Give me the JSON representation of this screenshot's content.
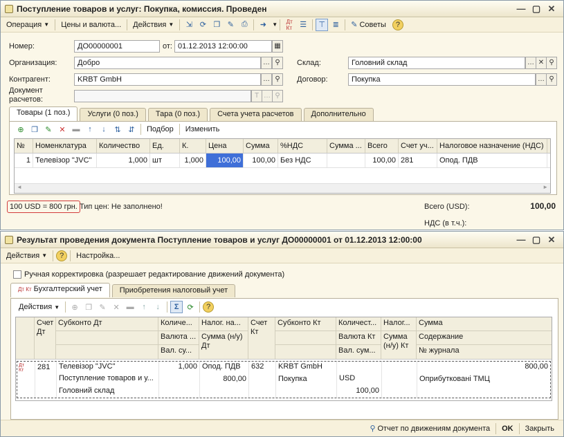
{
  "doc": {
    "title": "Поступление товаров и услуг: Покупка, комиссия. Проведен",
    "toolbar": {
      "operation": "Операция",
      "prices": "Цены и валюта...",
      "actions": "Действия",
      "advices": "Советы"
    },
    "fields": {
      "number_label": "Номер:",
      "number_value": "ДО00000001",
      "from_label": "от:",
      "date_value": "01.12.2013 12:00:00",
      "org_label": "Организация:",
      "org_value": "Добро",
      "warehouse_label": "Склад:",
      "warehouse_value": "Головний склад",
      "contractor_label": "Контрагент:",
      "contractor_value": "KRBT GmbH",
      "contract_label": "Договор:",
      "contract_value": "Покупка",
      "settlement_label": "Документ расчетов:",
      "settlement_value": ""
    },
    "tabs": [
      "Товары (1 поз.)",
      "Услуги (0 поз.)",
      "Тара (0 поз.)",
      "Счета учета расчетов",
      "Дополнительно"
    ],
    "grid_toolbar": {
      "selection": "Подбор",
      "change": "Изменить"
    },
    "columns": [
      "№",
      "Номенклатура",
      "Количество",
      "Ед.",
      "К.",
      "Цена",
      "Сумма",
      "%НДС",
      "Сумма ...",
      "Всего",
      "Счет уч...",
      "Налоговое назначение (НДС)"
    ],
    "rows": [
      [
        "1",
        "Телевізор \"JVC\"",
        "1,000",
        "шт",
        "1,000",
        "100,00",
        "100,00",
        "Без НДС",
        "",
        "100,00",
        "281",
        "Опод. ПДВ"
      ]
    ],
    "rate_note": "100 USD = 800 грн.",
    "price_type": "Тип цен: Не заполнено!",
    "total_label": "Всего (USD):",
    "total_value": "100,00",
    "vat_label": "НДС (в т.ч.):"
  },
  "result": {
    "title": "Результат проведения документа Поступление товаров и услуг ДО00000001 от 01.12.2013 12:00:00",
    "toolbar": {
      "actions": "Действия",
      "settings": "Настройка..."
    },
    "manual_label": "Ручная корректировка (разрешает редактирование движений документа)",
    "tabs": [
      "Бухгалтерский учет",
      "Приобретения налоговый учет"
    ],
    "grid_actions": "Действия",
    "header": {
      "row1": [
        "Счет Дт",
        "Субконто Дт",
        "Количе...",
        "Налог. на...",
        "Счет Кт",
        "Субконто Кт",
        "Количест...",
        "Налог...",
        "Сумма"
      ],
      "row2": [
        "Валюта ...",
        "Сумма (н/у) Дт",
        "Валюта Кт",
        "Сумма (н/у) Кт",
        "Содержание"
      ],
      "row3": [
        "Вал. су...",
        "Вал. сум...",
        "№ журнала"
      ]
    },
    "entry": {
      "account_dt": "281",
      "sub_dt_1": "Телевізор \"JVC\"",
      "sub_dt_2": "Поступление товаров и у...",
      "sub_dt_3": "Головний склад",
      "qty_dt": "1,000",
      "tax_dt": "Опод. ПДВ",
      "tax_sum_dt": "800,00",
      "account_kt": "632",
      "sub_kt_1": "KRBT GmbH",
      "sub_kt_2": "Покупка",
      "currency_kt": "USD",
      "cur_sum_kt": "100,00",
      "sum": "800,00",
      "content": "Оприбутковані ТМЦ"
    },
    "footer": {
      "report": "Отчет по движениям документа",
      "ok": "OK",
      "close": "Закрыть"
    }
  }
}
